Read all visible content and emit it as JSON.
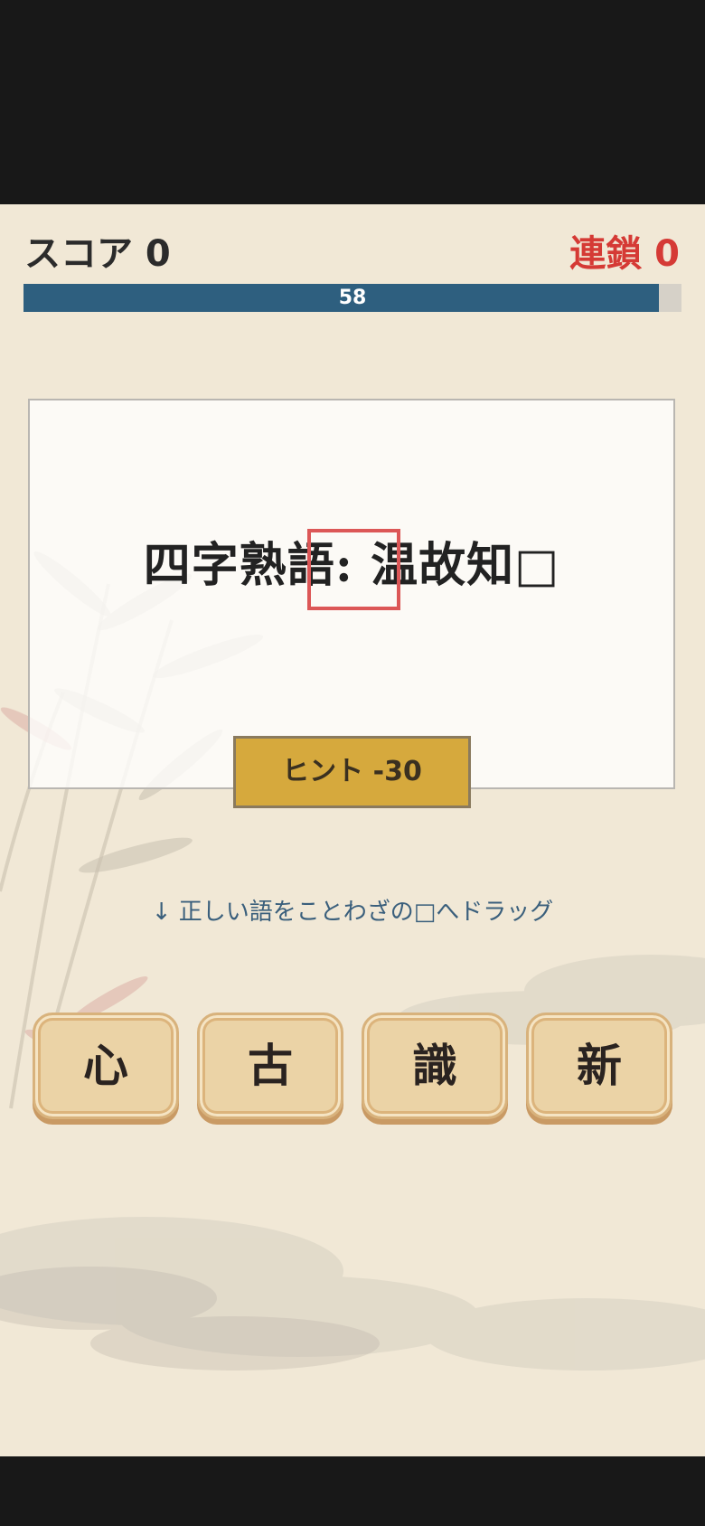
{
  "hud": {
    "score_label": "スコア 0",
    "chain_label": "連鎖 0"
  },
  "timer": {
    "value": "58",
    "fill_fraction": 0.966
  },
  "question": {
    "text": "四字熟語: 温故知□"
  },
  "hint_button": {
    "label": "ヒント -30"
  },
  "instruction": "↓ 正しい語をことわざの□へドラッグ",
  "tiles": [
    "心",
    "古",
    "識",
    "新"
  ],
  "colors": {
    "timer_fill": "#2e5f7f",
    "chain_text": "#d53a35",
    "hint_button": "#d6a93d",
    "slot_highlight": "#dc5757",
    "tile_face": "#ebd3a6"
  }
}
